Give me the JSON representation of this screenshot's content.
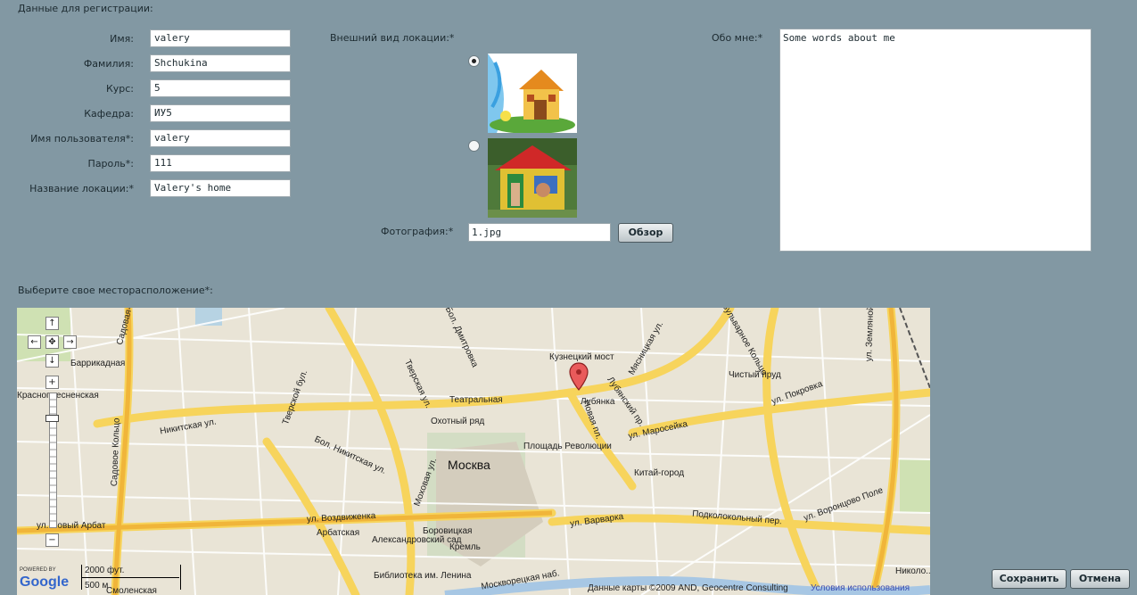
{
  "section_title": "Данные для регистрации:",
  "fields": [
    {
      "label": "Имя:",
      "value": "valery"
    },
    {
      "label": "Фамилия:",
      "value": "Shchukina"
    },
    {
      "label": "Курс:",
      "value": "5"
    },
    {
      "label": "Кафедра:",
      "value": "ИУ5"
    },
    {
      "label": "Имя пользователя*:",
      "value": "valery"
    },
    {
      "label": "Пароль*:",
      "value": "111"
    },
    {
      "label": "Название локации:*",
      "value": "Valery's home"
    }
  ],
  "appearance": {
    "label": "Внешний вид локации:*",
    "options": [
      {
        "name": "house-cartoon",
        "selected": true
      },
      {
        "name": "playhouse-photo",
        "selected": false
      }
    ]
  },
  "photo": {
    "label": "Фотография:*",
    "value": "1.jpg",
    "browse_label": "Обзор"
  },
  "about": {
    "label": "Обо мне:*",
    "value": "Some words about me"
  },
  "location_title": "Выберите свое месторасположение*:",
  "map": {
    "city": "Москва",
    "streets": [
      "Садовое Кольцо",
      "Бол. Никитская ул.",
      "Тверская ул.",
      "Моховая ул.",
      "ул. Воздвиженка",
      "ул. Новый Арбат",
      "Новая пл.",
      "ул. Маросейка",
      "ул. Покровка",
      "Мясницкая ул.",
      "ул. Варварка",
      "Бульварное Кольцо",
      "Подколокольный пер.",
      "ул. Воронцово Поле",
      "ул. Земляной Вал",
      "Москворецкая наб.",
      "ул. Бол. Дмитровка",
      "Лубянский пр.",
      "Никитская ул.",
      "Тверской бул.",
      "Гоголевский бул.",
      "Николо...",
      "Садовая-Кудринская ул."
    ],
    "stations": [
      "Кузнецкий мост",
      "Лубянка",
      "Театральная",
      "Охотный ряд",
      "Площадь Революции",
      "Китай-город",
      "Боровицкая",
      "Арбатская",
      "Александровский сад",
      "Библиотека им. Ленина",
      "Смоленская",
      "Баррикадная",
      "Краснопресненская"
    ],
    "places": [
      "Кремль",
      "Чистый пруд"
    ],
    "scale_ft": "2000 фут.",
    "scale_m": "500 м",
    "powered_by": "POWERED BY",
    "google": "Google",
    "attribution": "Данные карты ©2009 AND, Geocentre Consulting",
    "terms": "Условия использования",
    "controls": {
      "up": "↑",
      "down": "↓",
      "left": "←",
      "right": "→",
      "zoom_in": "+",
      "zoom_out": "−"
    }
  },
  "buttons": {
    "save": "Сохранить",
    "cancel": "Отмена"
  }
}
